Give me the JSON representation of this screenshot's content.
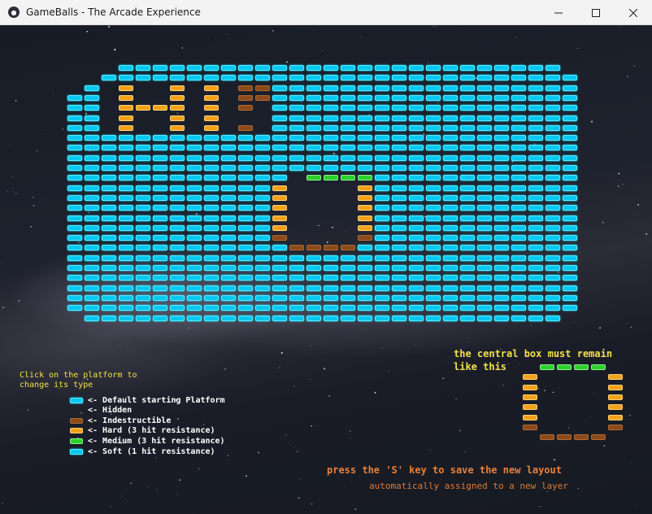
{
  "window": {
    "title": "GameBalls - The Arcade Experience",
    "minimize_icon": "minimize-icon",
    "maximize_icon": "maximize-icon",
    "close_icon": "close-icon"
  },
  "colors": {
    "soft": "#08c8f0",
    "hard": "#f2a21a",
    "medium": "#2bd12b",
    "indestructible": "#8b4a1c"
  },
  "instructions": {
    "line1": "Click on the platform to",
    "line2": "change its type"
  },
  "legend": [
    {
      "type": "soft",
      "label": "<- Default starting Platform"
    },
    {
      "type": "hidden",
      "label": "<- Hidden"
    },
    {
      "type": "indes",
      "label": "<- Indestructible"
    },
    {
      "type": "hard",
      "label": "<- Hard (3 hit resistance)"
    },
    {
      "type": "medium",
      "label": "<- Medium (3 hit resistance)"
    },
    {
      "type": "soft",
      "label": "<- Soft (1 hit resistance)"
    }
  ],
  "central_note": {
    "line1": "the central box must remain",
    "line2": "like this"
  },
  "save_hint": "press the 'S' key to save the new layout",
  "layer_hint": "automatically assigned to a new layer"
}
